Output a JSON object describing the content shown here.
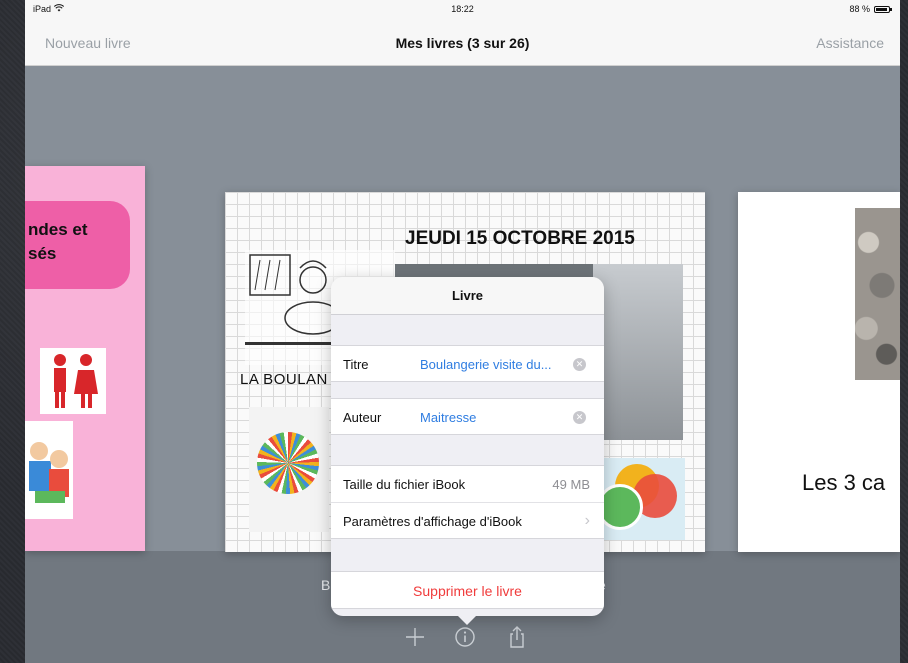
{
  "status_bar": {
    "device": "iPad",
    "time": "18:22",
    "battery": "88 %",
    "battery_level": 0.88
  },
  "nav": {
    "left_button": "Nouveau livre",
    "title": "Mes livres (3 sur 26)",
    "right_button": "Assistance"
  },
  "books": {
    "left_title": "ndes et\nsés",
    "center_date": "JEUDI 15 OCTOBRE 2015",
    "center_shop": "LA BOULAN",
    "right_title": "Les 3 ca",
    "caption_left": "B",
    "caption_right": "e"
  },
  "popover": {
    "title": "Livre",
    "titre_label": "Titre",
    "titre_value": "Boulangerie visite du...",
    "auteur_label": "Auteur",
    "auteur_value": "Maitresse",
    "taille_label": "Taille du fichier iBook",
    "taille_value": "49 MB",
    "params_label": "Paramètres d'affichage d'iBook",
    "delete_label": "Supprimer le livre"
  },
  "toolbar": {
    "icons": [
      "plus-icon",
      "info-icon",
      "share-icon"
    ]
  },
  "colors": {
    "accent_blue": "#2f7de1",
    "destructive_red": "#f03b3b",
    "background_gray": "#878f98"
  }
}
